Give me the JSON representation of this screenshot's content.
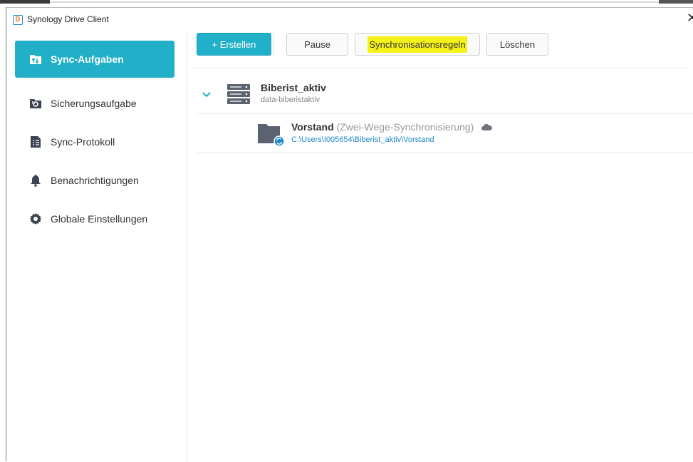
{
  "window": {
    "title": "Synology Drive Client",
    "logo_letter": "D"
  },
  "sidebar": {
    "items": [
      {
        "label": "Sync-Aufgaben",
        "icon": "sync-tasks-icon",
        "active": true
      },
      {
        "label": "Sicherungsaufgabe",
        "icon": "backup-icon",
        "active": false
      },
      {
        "label": "Sync-Protokoll",
        "icon": "log-icon",
        "active": false
      },
      {
        "label": "Benachrichtigungen",
        "icon": "bell-icon",
        "active": false
      },
      {
        "label": "Globale Einstellungen",
        "icon": "gear-icon",
        "active": false
      }
    ]
  },
  "toolbar": {
    "create_label": "+ Erstellen",
    "pause_label": "Pause",
    "rules_label": "Synchronisationsregeln",
    "delete_label": "Löschen"
  },
  "task": {
    "name": "Biberist_aktiv",
    "server": "data-biberistaktiv",
    "folders": [
      {
        "name": "Vorstand",
        "mode": "(Zwei-Wege-Synchronisierung)",
        "path": "C:\\Users\\I005654\\Biberist_aktiv\\Vorstand"
      }
    ]
  },
  "colors": {
    "accent": "#21b0c8",
    "highlight": "#f5f21a",
    "link": "#1e88c8"
  }
}
